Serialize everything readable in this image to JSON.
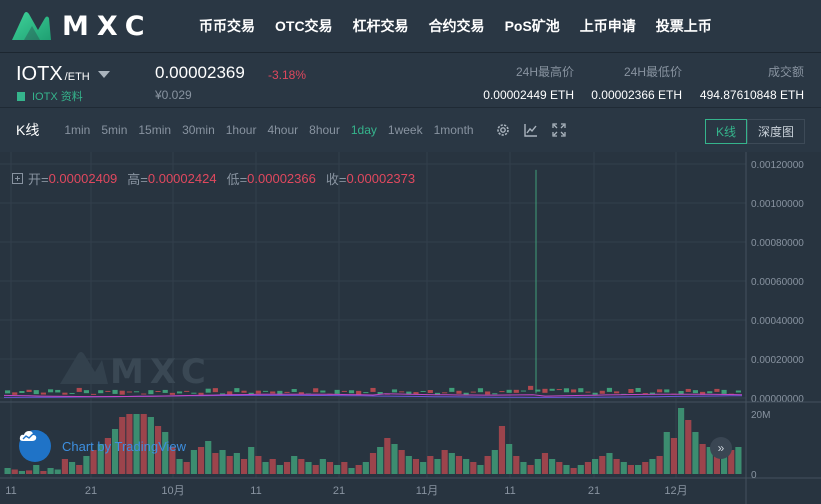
{
  "brand": {
    "name": "MXC"
  },
  "nav": {
    "items": [
      "币币交易",
      "OTC交易",
      "杠杆交易",
      "合约交易",
      "PoS矿池",
      "上币申请",
      "投票上币"
    ]
  },
  "ticker": {
    "symbol": "IOTX",
    "quote": "/ETH",
    "info_link": "IOTX 资料",
    "price": "0.00002369",
    "change": "-3.18%",
    "cny": "¥0.029",
    "high_label": "24H最高价",
    "high_value": "0.00002449 ETH",
    "low_label": "24H最低价",
    "low_value": "0.00002366 ETH",
    "volume_label": "成交额",
    "volume_value": "494.87610848 ETH"
  },
  "toolbar": {
    "title": "K线",
    "intervals": [
      "1min",
      "5min",
      "15min",
      "30min",
      "1hour",
      "4hour",
      "8hour",
      "1day",
      "1week",
      "1month"
    ],
    "active_interval": "1day",
    "views": [
      "K线",
      "深度图"
    ],
    "active_view": "K线"
  },
  "ohlc": {
    "open_label": "开=",
    "open": "0.00002409",
    "high_label": "高=",
    "high": "0.00002424",
    "low_label": "低=",
    "low": "0.00002366",
    "close_label": "收=",
    "close": "0.00002373"
  },
  "watermark": "MXC",
  "tradingview": {
    "label": "Chart by TradingView"
  },
  "colors": {
    "up": "#3f9e79",
    "down": "#b0484f",
    "accent": "#35b48c",
    "ma1": "#c347c5",
    "ma2": "#6b56d6"
  },
  "chart_data": {
    "type": "candlestick",
    "price_axis": {
      "ticks": [
        "0.00120000",
        "0.00100000",
        "0.00080000",
        "0.00060000",
        "0.00040000",
        "0.00020000",
        "0.00000000"
      ],
      "ylim": [
        0,
        0.0012
      ]
    },
    "volume_axis": {
      "ticks": [
        "20M",
        "0"
      ],
      "ylim": [
        0,
        20
      ]
    },
    "x_labels": [
      "11",
      "21",
      "10月",
      "11",
      "21",
      "11月",
      "11",
      "21",
      "12月"
    ],
    "close_level": 2.373e-05,
    "spike": {
      "label_index": 6,
      "high": 0.00117
    },
    "volume_series": [
      {
        "up": true,
        "v": 2
      },
      {
        "up": false,
        "v": 1.5
      },
      {
        "up": true,
        "v": 1
      },
      {
        "up": false,
        "v": 1.2
      },
      {
        "up": true,
        "v": 3
      },
      {
        "up": false,
        "v": 1
      },
      {
        "up": true,
        "v": 2
      },
      {
        "up": true,
        "v": 1.5
      },
      {
        "up": false,
        "v": 5
      },
      {
        "up": true,
        "v": 4
      },
      {
        "up": false,
        "v": 3
      },
      {
        "up": true,
        "v": 6
      },
      {
        "up": false,
        "v": 8
      },
      {
        "up": true,
        "v": 10
      },
      {
        "up": false,
        "v": 12
      },
      {
        "up": true,
        "v": 15
      },
      {
        "up": false,
        "v": 19
      },
      {
        "up": false,
        "v": 20
      },
      {
        "up": true,
        "v": 20
      },
      {
        "up": false,
        "v": 20
      },
      {
        "up": true,
        "v": 19
      },
      {
        "up": false,
        "v": 16
      },
      {
        "up": true,
        "v": 14
      },
      {
        "up": false,
        "v": 9
      },
      {
        "up": true,
        "v": 5
      },
      {
        "up": false,
        "v": 4
      },
      {
        "up": true,
        "v": 8
      },
      {
        "up": false,
        "v": 9
      },
      {
        "up": true,
        "v": 11
      },
      {
        "up": false,
        "v": 7
      },
      {
        "up": true,
        "v": 8
      },
      {
        "up": false,
        "v": 6
      },
      {
        "up": true,
        "v": 7
      },
      {
        "up": false,
        "v": 5
      },
      {
        "up": true,
        "v": 9
      },
      {
        "up": false,
        "v": 6
      },
      {
        "up": true,
        "v": 4
      },
      {
        "up": false,
        "v": 5
      },
      {
        "up": true,
        "v": 3
      },
      {
        "up": false,
        "v": 4
      },
      {
        "up": true,
        "v": 6
      },
      {
        "up": false,
        "v": 5
      },
      {
        "up": true,
        "v": 4
      },
      {
        "up": false,
        "v": 3
      },
      {
        "up": true,
        "v": 5
      },
      {
        "up": false,
        "v": 4
      },
      {
        "up": true,
        "v": 3
      },
      {
        "up": false,
        "v": 4
      },
      {
        "up": true,
        "v": 2
      },
      {
        "up": false,
        "v": 3
      },
      {
        "up": true,
        "v": 4
      },
      {
        "up": false,
        "v": 7
      },
      {
        "up": true,
        "v": 9
      },
      {
        "up": false,
        "v": 12
      },
      {
        "up": true,
        "v": 10
      },
      {
        "up": false,
        "v": 8
      },
      {
        "up": true,
        "v": 6
      },
      {
        "up": false,
        "v": 5
      },
      {
        "up": true,
        "v": 4
      },
      {
        "up": false,
        "v": 6
      },
      {
        "up": true,
        "v": 5
      },
      {
        "up": false,
        "v": 8
      },
      {
        "up": true,
        "v": 7
      },
      {
        "up": false,
        "v": 6
      },
      {
        "up": true,
        "v": 5
      },
      {
        "up": false,
        "v": 4
      },
      {
        "up": true,
        "v": 3
      },
      {
        "up": false,
        "v": 6
      },
      {
        "up": true,
        "v": 8
      },
      {
        "up": false,
        "v": 16
      },
      {
        "up": true,
        "v": 10
      },
      {
        "up": false,
        "v": 6
      },
      {
        "up": true,
        "v": 4
      },
      {
        "up": false,
        "v": 3
      },
      {
        "up": true,
        "v": 5
      },
      {
        "up": false,
        "v": 7
      },
      {
        "up": true,
        "v": 5
      },
      {
        "up": false,
        "v": 4
      },
      {
        "up": true,
        "v": 3
      },
      {
        "up": false,
        "v": 2
      },
      {
        "up": true,
        "v": 3
      },
      {
        "up": false,
        "v": 4
      },
      {
        "up": true,
        "v": 5
      },
      {
        "up": false,
        "v": 6
      },
      {
        "up": true,
        "v": 7
      },
      {
        "up": false,
        "v": 5
      },
      {
        "up": true,
        "v": 4
      },
      {
        "up": false,
        "v": 3
      },
      {
        "up": true,
        "v": 3
      },
      {
        "up": false,
        "v": 4
      },
      {
        "up": true,
        "v": 5
      },
      {
        "up": false,
        "v": 6
      },
      {
        "up": true,
        "v": 14
      },
      {
        "up": false,
        "v": 12
      },
      {
        "up": true,
        "v": 22
      },
      {
        "up": false,
        "v": 18
      },
      {
        "up": true,
        "v": 14
      },
      {
        "up": false,
        "v": 10
      },
      {
        "up": true,
        "v": 9
      },
      {
        "up": false,
        "v": 10
      },
      {
        "up": true,
        "v": 11
      },
      {
        "up": false,
        "v": 8
      },
      {
        "up": true,
        "v": 9
      }
    ]
  }
}
